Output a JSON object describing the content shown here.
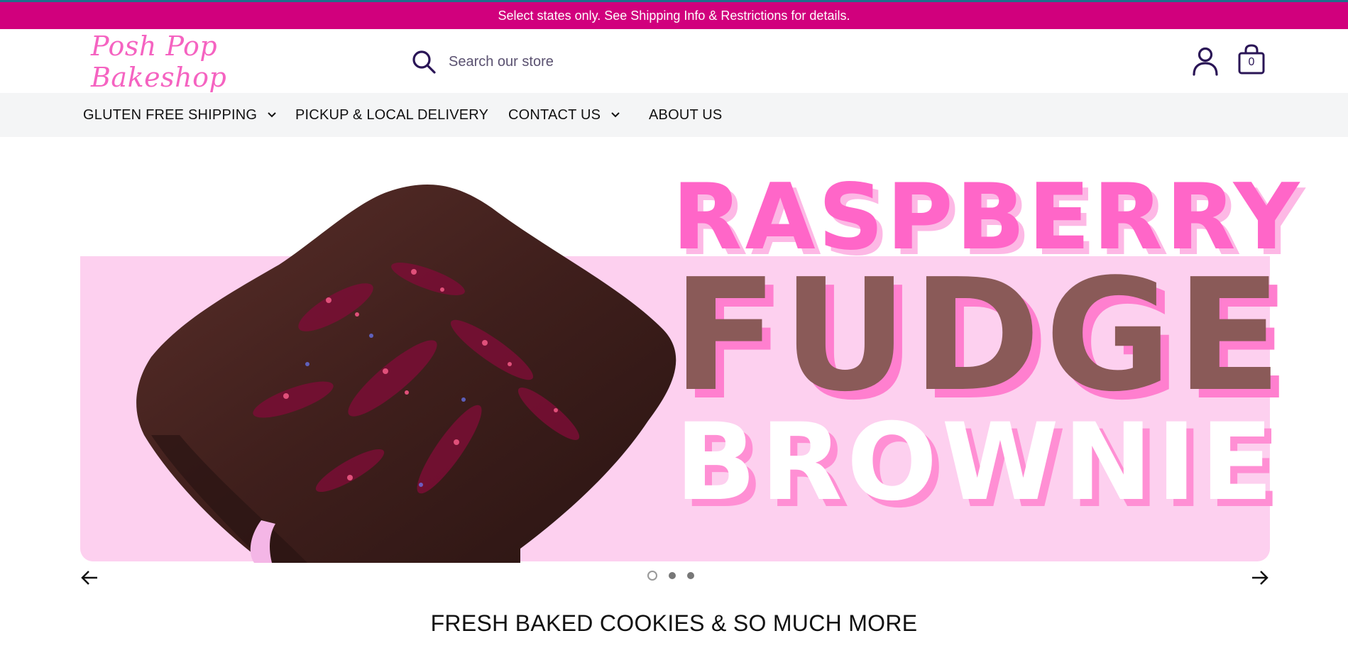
{
  "announcement": {
    "text": "Select states only. See Shipping Info & Restrictions for details."
  },
  "header": {
    "logo_text": "Posh Pop Bakeshop",
    "search": {
      "placeholder": "Search our store",
      "value": ""
    },
    "cart_count": "0"
  },
  "nav": {
    "items": [
      {
        "label": "GLUTEN FREE SHIPPING",
        "has_dropdown": true
      },
      {
        "label": "PICKUP & LOCAL DELIVERY",
        "has_dropdown": false
      },
      {
        "label": "CONTACT US",
        "has_dropdown": true
      },
      {
        "label": "ABOUT US",
        "has_dropdown": false
      }
    ]
  },
  "hero": {
    "line1": "RASPBERRY",
    "line2": "FUDGE",
    "line3": "BROWNIE",
    "slide_count": 3,
    "active_slide": 1
  },
  "section": {
    "title": "FRESH BAKED COOKIES & SO MUCH MORE"
  },
  "colors": {
    "announcement_bg": "#d1007d",
    "logo": "#f563c1",
    "hero_band": "#fdd0ef",
    "icon": "#2a1556"
  },
  "icons": [
    "search-icon",
    "account-icon",
    "cart-icon",
    "chevron-down-icon",
    "arrow-left-icon",
    "arrow-right-icon"
  ]
}
